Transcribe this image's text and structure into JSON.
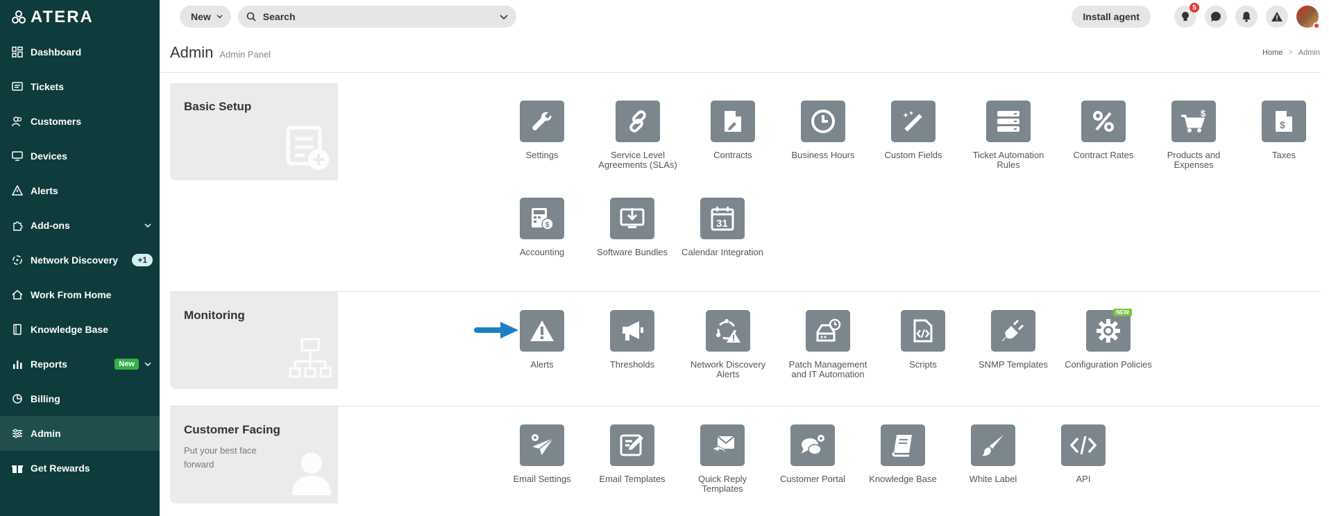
{
  "app": {
    "logo_text": "ATERA"
  },
  "sidebar": {
    "items": [
      {
        "label": "Dashboard",
        "icon": "dashboard-icon"
      },
      {
        "label": "Tickets",
        "icon": "tickets-icon"
      },
      {
        "label": "Customers",
        "icon": "customers-icon"
      },
      {
        "label": "Devices",
        "icon": "devices-icon"
      },
      {
        "label": "Alerts",
        "icon": "alerts-icon"
      },
      {
        "label": "Add-ons",
        "icon": "addons-icon"
      },
      {
        "label": "Network Discovery",
        "icon": "network-discovery-icon",
        "badge": "+1"
      },
      {
        "label": "Work From Home",
        "icon": "home-icon"
      },
      {
        "label": "Knowledge Base",
        "icon": "book-icon"
      },
      {
        "label": "Reports",
        "icon": "reports-icon",
        "badge": "New"
      },
      {
        "label": "Billing",
        "icon": "billing-icon"
      },
      {
        "label": "Admin",
        "icon": "admin-icon",
        "active": true
      },
      {
        "label": "Get Rewards",
        "icon": "gift-icon"
      }
    ]
  },
  "topbar": {
    "new_label": "New",
    "search_placeholder": "Search",
    "install_label": "Install agent",
    "tips_count": "5"
  },
  "header": {
    "title": "Admin",
    "subtitle": "Admin Panel",
    "breadcrumb": [
      "Home",
      "Admin"
    ],
    "breadcrumb_sep": ">"
  },
  "sections": {
    "basic": {
      "title": "Basic Setup",
      "tiles": [
        "Settings",
        "Service Level Agreements (SLAs)",
        "Contracts",
        "Business Hours",
        "Custom Fields",
        "Ticket Automation Rules",
        "Contract Rates",
        "Products and Expenses",
        "Taxes",
        "Accounting",
        "Software Bundles",
        "Calendar Integration"
      ]
    },
    "monitoring": {
      "title": "Monitoring",
      "tiles": [
        "Alerts",
        "Thresholds",
        "Network Discovery Alerts",
        "Patch Management and IT Automation",
        "Scripts",
        "SNMP Templates",
        "Configuration Policies"
      ],
      "new_tag": "NEW"
    },
    "customer": {
      "title": "Customer Facing",
      "description": "Put your best face forward",
      "tiles": [
        "Email Settings",
        "Email Templates",
        "Quick Reply Templates",
        "Customer Portal",
        "Knowledge Base",
        "White Label",
        "API"
      ]
    }
  },
  "colors": {
    "sidebar_bg": "#0e3b3b",
    "tile_bg": "#7c868d",
    "arrow": "#1d7fc4",
    "new_badge": "#35b047"
  }
}
